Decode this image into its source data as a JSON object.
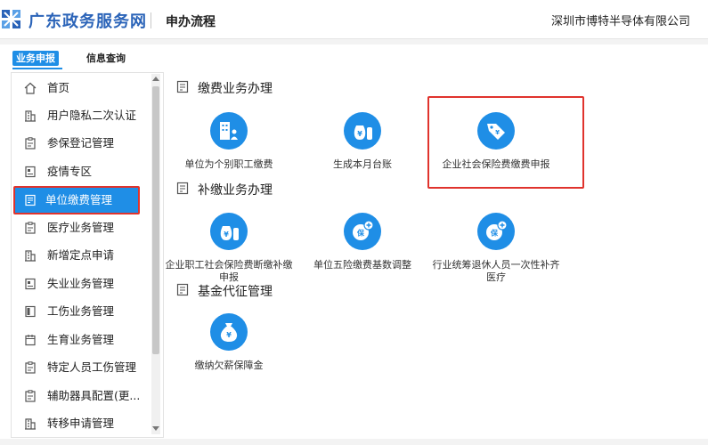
{
  "header": {
    "site_title": "广东政务服务网",
    "subtitle": "申办流程",
    "company": "深圳市博特半导体有限公司"
  },
  "tabs": [
    "业务申报",
    "信息查询"
  ],
  "sidebar": {
    "items": [
      {
        "label": "首页",
        "icon": "home-icon"
      },
      {
        "label": "用户隐私二次认证",
        "icon": "building-icon"
      },
      {
        "label": "参保登记管理",
        "icon": "clipboard-icon"
      },
      {
        "label": "疫情专区",
        "icon": "id-card-icon"
      },
      {
        "label": "单位缴费管理",
        "icon": "form-icon",
        "active": true
      },
      {
        "label": "医疗业务管理",
        "icon": "clipboard-icon"
      },
      {
        "label": "新增定点申请",
        "icon": "building-icon"
      },
      {
        "label": "失业业务管理",
        "icon": "id-card-icon"
      },
      {
        "label": "工伤业务管理",
        "icon": "document-icon"
      },
      {
        "label": "生育业务管理",
        "icon": "calendar-icon"
      },
      {
        "label": "特定人员工伤管理",
        "icon": "clipboard-icon"
      },
      {
        "label": "辅助器具配置(更...",
        "icon": "clipboard-icon"
      },
      {
        "label": "转移申请管理",
        "icon": "building-icon"
      }
    ]
  },
  "sections": [
    {
      "title": "缴费业务办理",
      "services": [
        {
          "label": "单位为个别职工缴费",
          "icon": "building-person-icon"
        },
        {
          "label": "生成本月台账",
          "icon": "money-bag-icon"
        },
        {
          "label": "企业社会保险费缴费申报",
          "icon": "price-tag-icon"
        }
      ]
    },
    {
      "title": "补缴业务办理",
      "services": [
        {
          "label": "企业职工社会保险费断缴补缴申报",
          "icon": "money-bag-icon"
        },
        {
          "label": "单位五险缴费基数调整",
          "icon": "insurance-plus-icon"
        },
        {
          "label": "行业统筹退休人员一次性补齐医疗",
          "icon": "insurance-plus-icon"
        }
      ]
    },
    {
      "title": "基金代征管理",
      "services": [
        {
          "label": "缴纳欠薪保障金",
          "icon": "yuan-bag-icon"
        }
      ]
    }
  ],
  "colors": {
    "brand": "#2a63b8",
    "accent": "#1f8ee6",
    "highlight": "#e0332d"
  }
}
